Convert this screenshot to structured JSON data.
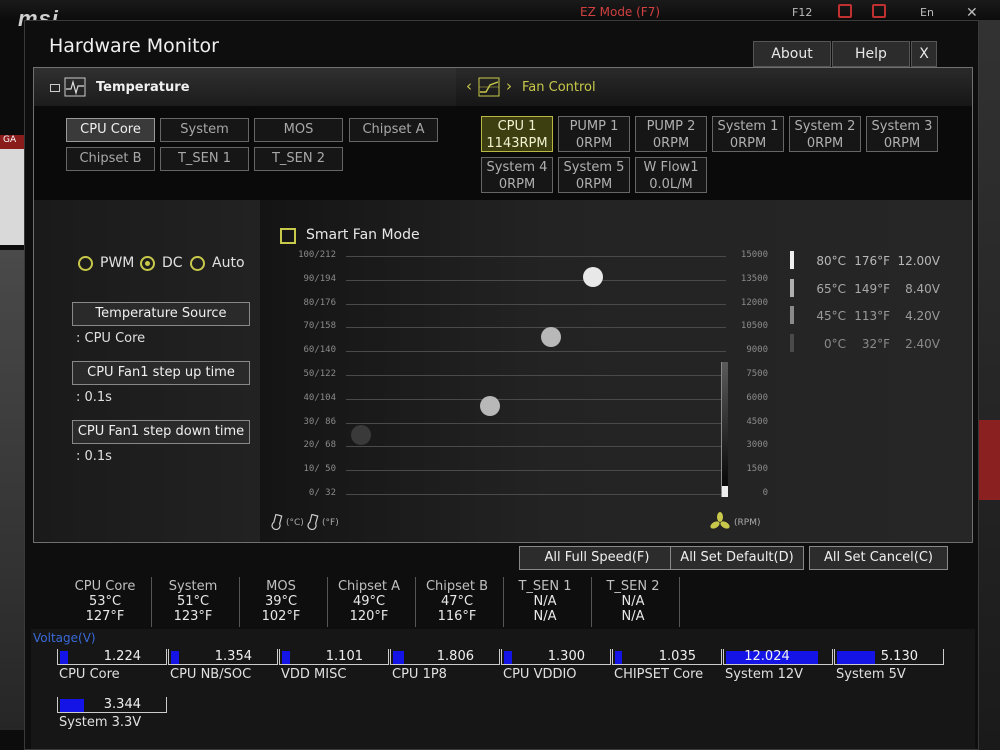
{
  "background": {
    "logo": "msi",
    "mode_label": "EZ Mode (F7)",
    "f12_label": "F12",
    "lang_label": "En",
    "close_label": "✕",
    "side_tag": "GA"
  },
  "window": {
    "title": "Hardware Monitor",
    "about_label": "About",
    "help_label": "Help",
    "close_label": "X"
  },
  "tabs": {
    "temperature_label": "Temperature",
    "fan_control_label": "Fan Control",
    "fan_prefix": "‹",
    "fan_arrow": "›"
  },
  "temperature_sources": [
    {
      "label": "CPU Core",
      "selected": true
    },
    {
      "label": "System",
      "selected": false
    },
    {
      "label": "MOS",
      "selected": false
    },
    {
      "label": "Chipset A",
      "selected": false
    },
    {
      "label": "Chipset B",
      "selected": false
    },
    {
      "label": "T_SEN 1",
      "selected": false
    },
    {
      "label": "T_SEN 2",
      "selected": false
    }
  ],
  "fans": [
    {
      "name": "CPU 1",
      "value": "1143RPM",
      "selected": true
    },
    {
      "name": "PUMP 1",
      "value": "0RPM",
      "selected": false
    },
    {
      "name": "PUMP 2",
      "value": "0RPM",
      "selected": false
    },
    {
      "name": "System 1",
      "value": "0RPM",
      "selected": false
    },
    {
      "name": "System 2",
      "value": "0RPM",
      "selected": false
    },
    {
      "name": "System 3",
      "value": "0RPM",
      "selected": false
    },
    {
      "name": "System 4",
      "value": "0RPM",
      "selected": false
    },
    {
      "name": "System 5",
      "value": "0RPM",
      "selected": false
    },
    {
      "name": "W Flow1",
      "value": "0.0L/M",
      "selected": false
    }
  ],
  "mode": {
    "options": [
      "PWM",
      "DC",
      "Auto"
    ],
    "selected": "DC"
  },
  "settings": {
    "temp_source_label": "Temperature Source",
    "temp_source_value": ": CPU Core",
    "step_up_label": "CPU Fan1 step up time",
    "step_up_value": ": 0.1s",
    "step_down_label": "CPU Fan1 step down time",
    "step_down_value": ": 0.1s"
  },
  "smart_fan": {
    "label": "Smart Fan Mode",
    "checked": false
  },
  "chart_data": {
    "type": "scatter",
    "title": "",
    "xlabel": "",
    "ylabel_left_unit_c": "(°C)",
    "ylabel_left_unit_f": "(°F)",
    "ylabel_right_unit": "(RPM)",
    "left_ticks": [
      "100/212",
      "90/194",
      "80/176",
      "70/158",
      "60/140",
      "50/122",
      "40/104",
      "30/ 86",
      "20/ 68",
      "10/ 50",
      "0/ 32"
    ],
    "right_ticks": [
      "15000",
      "13500",
      "12000",
      "10500",
      "9000",
      "7500",
      "6000",
      "4500",
      "3000",
      "1500",
      "0"
    ],
    "ylim_celsius": [
      0,
      100
    ],
    "ylim_rpm": [
      0,
      15000
    ],
    "points": [
      {
        "x": 0.04,
        "y": 25,
        "state": "disabled"
      },
      {
        "x": 0.38,
        "y": 37,
        "state": "active"
      },
      {
        "x": 0.54,
        "y": 66,
        "state": "active"
      },
      {
        "x": 0.65,
        "y": 91,
        "state": "active"
      }
    ],
    "current_rpm_level": 0.08,
    "grid": true
  },
  "voltage_legend": [
    {
      "celsius": "80°C",
      "fahrenheit": "176°F",
      "volt": "12.00V",
      "level": "high"
    },
    {
      "celsius": "65°C",
      "fahrenheit": "149°F",
      "volt": "8.40V",
      "level": "mid"
    },
    {
      "celsius": "45°C",
      "fahrenheit": "113°F",
      "volt": "4.20V",
      "level": "low"
    },
    {
      "celsius": "0°C",
      "fahrenheit": "32°F",
      "volt": "2.40V",
      "level": "min"
    }
  ],
  "actions": {
    "full_speed": "All Full Speed(F)",
    "set_default": "All Set Default(D)",
    "set_cancel": "All Set Cancel(C)"
  },
  "temperatures": [
    {
      "name": "CPU Core",
      "c": "53°C",
      "f": "127°F"
    },
    {
      "name": "System",
      "c": "51°C",
      "f": "123°F"
    },
    {
      "name": "MOS",
      "c": "39°C",
      "f": "102°F"
    },
    {
      "name": "Chipset A",
      "c": "49°C",
      "f": "120°F"
    },
    {
      "name": "Chipset B",
      "c": "47°C",
      "f": "116°F"
    },
    {
      "name": "T_SEN 1",
      "c": "N/A",
      "f": "N/A"
    },
    {
      "name": "T_SEN 2",
      "c": "N/A",
      "f": "N/A"
    }
  ],
  "voltage": {
    "title": "Voltage(V)",
    "items": [
      {
        "name": "CPU Core",
        "value": "1.224",
        "level": 0.08
      },
      {
        "name": "CPU NB/SOC",
        "value": "1.354",
        "level": 0.08
      },
      {
        "name": "VDD MISC",
        "value": "1.101",
        "level": 0.08
      },
      {
        "name": "CPU 1P8",
        "value": "1.806",
        "level": 0.1
      },
      {
        "name": "CPU VDDIO",
        "value": "1.300",
        "level": 0.08
      },
      {
        "name": "CHIPSET Core",
        "value": "1.035",
        "level": 0.07
      },
      {
        "name": "System 12V",
        "value": "12.024",
        "level": 0.87
      },
      {
        "name": "System 5V",
        "value": "5.130",
        "level": 0.36
      },
      {
        "name": "System 3.3V",
        "value": "3.344",
        "level": 0.23
      }
    ]
  }
}
